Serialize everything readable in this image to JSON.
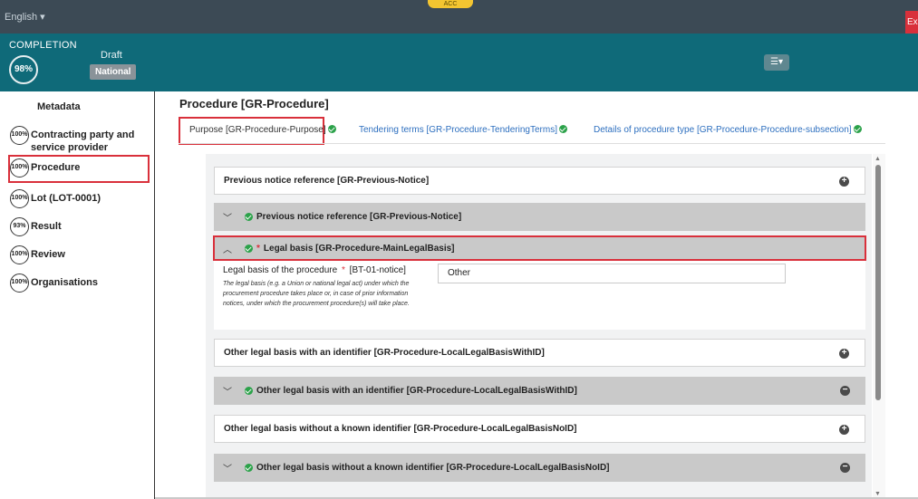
{
  "topbar": {
    "language": "English",
    "env_badge": "ACC",
    "exit_label": "Ex"
  },
  "header": {
    "completion_label": "COMPLETION",
    "completion_percent": "98%",
    "status_draft": "Draft",
    "status_national": "National",
    "settings_icon": "sliders-icon"
  },
  "sidebar": {
    "heading": "Metadata",
    "items": [
      {
        "percent": "100%",
        "label": "Contracting party and service provider"
      },
      {
        "percent": "100%",
        "label": "Procedure"
      },
      {
        "percent": "100%",
        "label": "Lot (LOT-0001)"
      },
      {
        "percent": "93%",
        "label": "Result"
      },
      {
        "percent": "100%",
        "label": "Review"
      },
      {
        "percent": "100%",
        "label": "Organisations"
      }
    ]
  },
  "main": {
    "title": "Procedure [GR-Procedure]",
    "tabs": [
      {
        "label": "Purpose  [GR-Procedure-Purpose]"
      },
      {
        "label": "Tendering terms  [GR-Procedure-TenderingTerms]"
      },
      {
        "label": "Details of procedure type  [GR-Procedure-Procedure-subsection]"
      }
    ]
  },
  "sections": {
    "prev_notice_collapsed": "Previous notice reference  [GR-Previous-Notice]",
    "prev_notice_expanded": "Previous notice reference  [GR-Previous-Notice]",
    "legal_basis": "Legal basis  [GR-Procedure-MainLegalBasis]",
    "legal_basis_field_label": "Legal basis of the procedure",
    "legal_basis_field_code": "[BT-01-notice]",
    "legal_basis_help": "The legal basis (e.g. a Union or national legal act) under which the procurement procedure takes place or, in case of prior information notices, under which the procurement procedure(s) will take place.",
    "legal_basis_value": "Other",
    "other_with_id_collapsed": "Other legal basis with an identifier  [GR-Procedure-LocalLegalBasisWithID]",
    "other_with_id_expanded": "Other legal basis with an identifier  [GR-Procedure-LocalLegalBasisWithID]",
    "other_no_id_collapsed": "Other legal basis without a known identifier  [GR-Procedure-LocalLegalBasisNoID]",
    "other_no_id_expanded": "Other legal basis without a known identifier  [GR-Procedure-LocalLegalBasisNoID]"
  },
  "colors": {
    "header_teal": "#0f6a79",
    "topbar": "#3c4a55",
    "highlight_red": "#d9303b",
    "link_blue": "#2d6fbf",
    "check_green": "#2ca24a"
  }
}
